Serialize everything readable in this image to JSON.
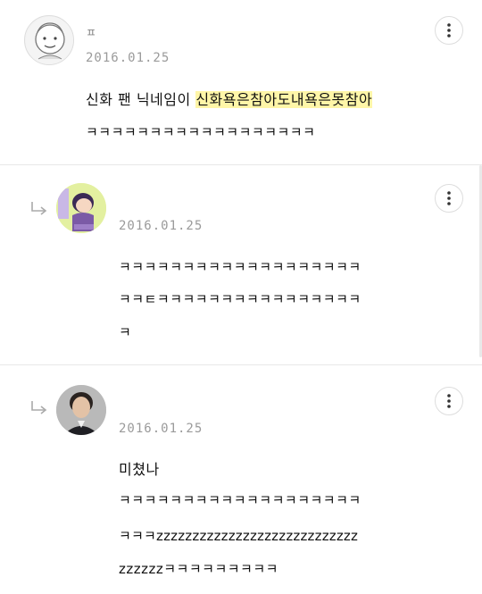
{
  "comments": [
    {
      "author": "ㅍ",
      "date": "2016.01.25",
      "lines": [
        {
          "plain": "신화 팬 닉네임이 ",
          "highlight": "신화욕은참아도내욕은못참아"
        },
        {
          "plain": "ㅋㅋㅋㅋㅋㅋㅋㅋㅋㅋㅋㅋㅋㅋㅋㅋㅋㅋ"
        }
      ]
    },
    {
      "author": "",
      "date": "2016.01.25",
      "lines": [
        "ㅋㅋㅋㅋㅋㅋㅋㅋㅋㅋㅋㅋㅋㅋㅋㅋㅋㅋㅋ",
        "ㅋㅋㅌㅋㅋㅋㅋㅋㅋㅋㅋㅋㅋㅋㅋㅋㅋㅋㅋ",
        "ㅋ"
      ]
    },
    {
      "author": "",
      "date": "2016.01.25",
      "lines": [
        "미쳤나",
        "ㅋㅋㅋㅋㅋㅋㅋㅋㅋㅋㅋㅋㅋㅋㅋㅋㅋㅋㅋ",
        "ㅋㅋㅋzzzzzzzzzzzzzzzzzzzzzzzzzzzz",
        "zzzzzzㅋㅋㅋㅋㅋㅋㅋㅋㅋ"
      ]
    }
  ]
}
